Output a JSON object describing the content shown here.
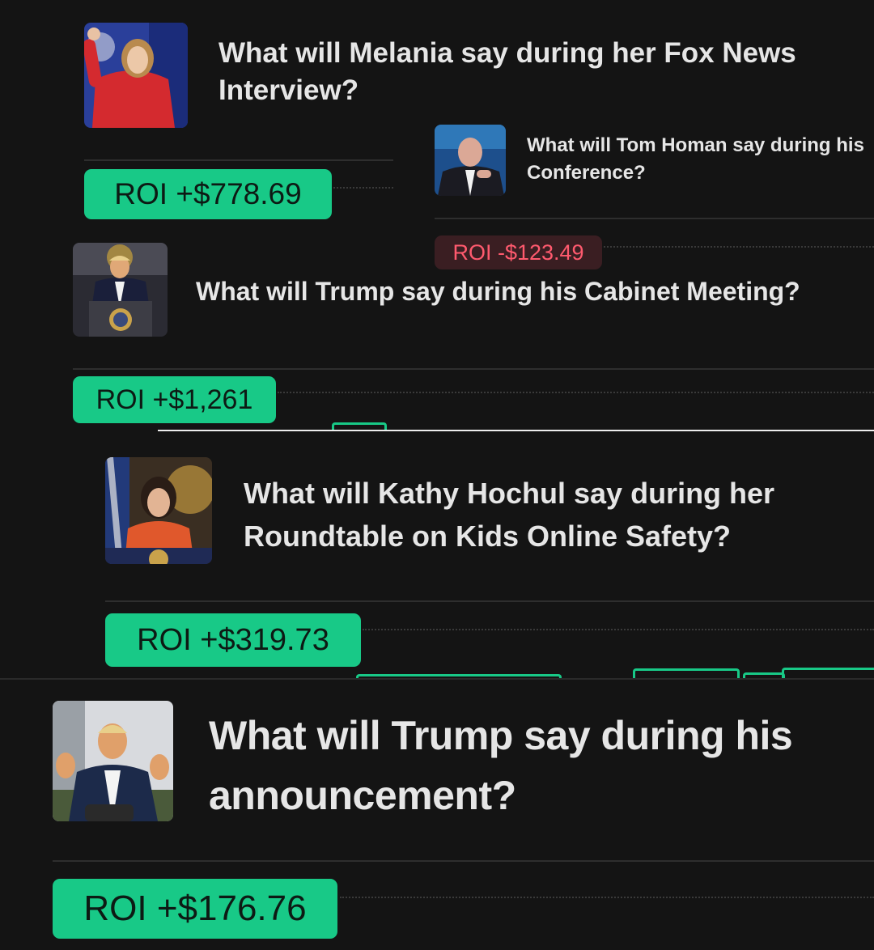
{
  "cards": [
    {
      "title": "What will Melania say during her Fox News Interview?",
      "roi": "ROI +$778.69",
      "roi_status": "positive",
      "image_alt": "Melania Trump waving in red"
    },
    {
      "title": "What will Tom Homan say during his Conference?",
      "roi": "ROI -$123.49",
      "roi_status": "negative",
      "image_alt": "Tom Homan speaking"
    },
    {
      "title": "What will Trump say during his Cabinet Meeting?",
      "roi": "ROI +$1,261",
      "roi_status": "positive",
      "image_alt": "Trump at presidential podium"
    },
    {
      "title": "What will Kathy Hochul say during her Roundtable on Kids Online Safety?",
      "roi": "ROI +$319.73",
      "roi_status": "positive",
      "image_alt": "Kathy Hochul at podium"
    },
    {
      "title": "What will Trump say during his announcement?",
      "roi": "ROI +$176.76",
      "roi_status": "positive",
      "image_alt": "Trump gesturing outdoors"
    }
  ],
  "colors": {
    "background": "#141414",
    "positive": "#18c987",
    "negative_text": "#ff5a6e",
    "negative_bg": "#3a1e22",
    "divider": "#2e2e2e"
  }
}
